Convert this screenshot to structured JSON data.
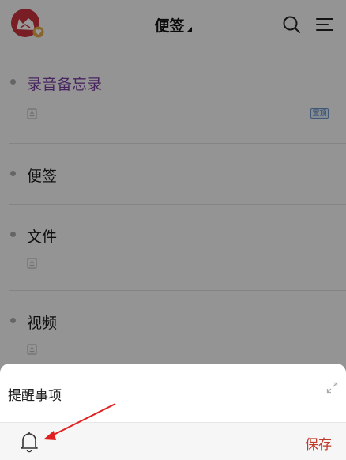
{
  "header": {
    "title": "便签",
    "avatar_icon": "user-avatar",
    "badge_icon": "vip-heart-badge",
    "search_icon": "search-icon",
    "menu_icon": "menu-icon"
  },
  "notes": [
    {
      "title": "录音备忘录",
      "has_attachment": true,
      "pinned": true,
      "pin_label": "置顶",
      "accent": "#7a3fa0"
    },
    {
      "title": "便签",
      "has_attachment": false,
      "pinned": false
    },
    {
      "title": "文件",
      "has_attachment": true,
      "pinned": false
    },
    {
      "title": "视频",
      "has_attachment": true,
      "pinned": false
    }
  ],
  "sheet": {
    "input_text": "提醒事项",
    "expand_icon": "expand-icon",
    "reminder_icon": "bell-icon",
    "save_label": "保存",
    "save_color": "#c0392b"
  },
  "annotation": {
    "arrow_color": "#e02020"
  },
  "colors": {
    "brand": "#c8323c",
    "overlay": "rgba(0,0,0,0.40)"
  }
}
